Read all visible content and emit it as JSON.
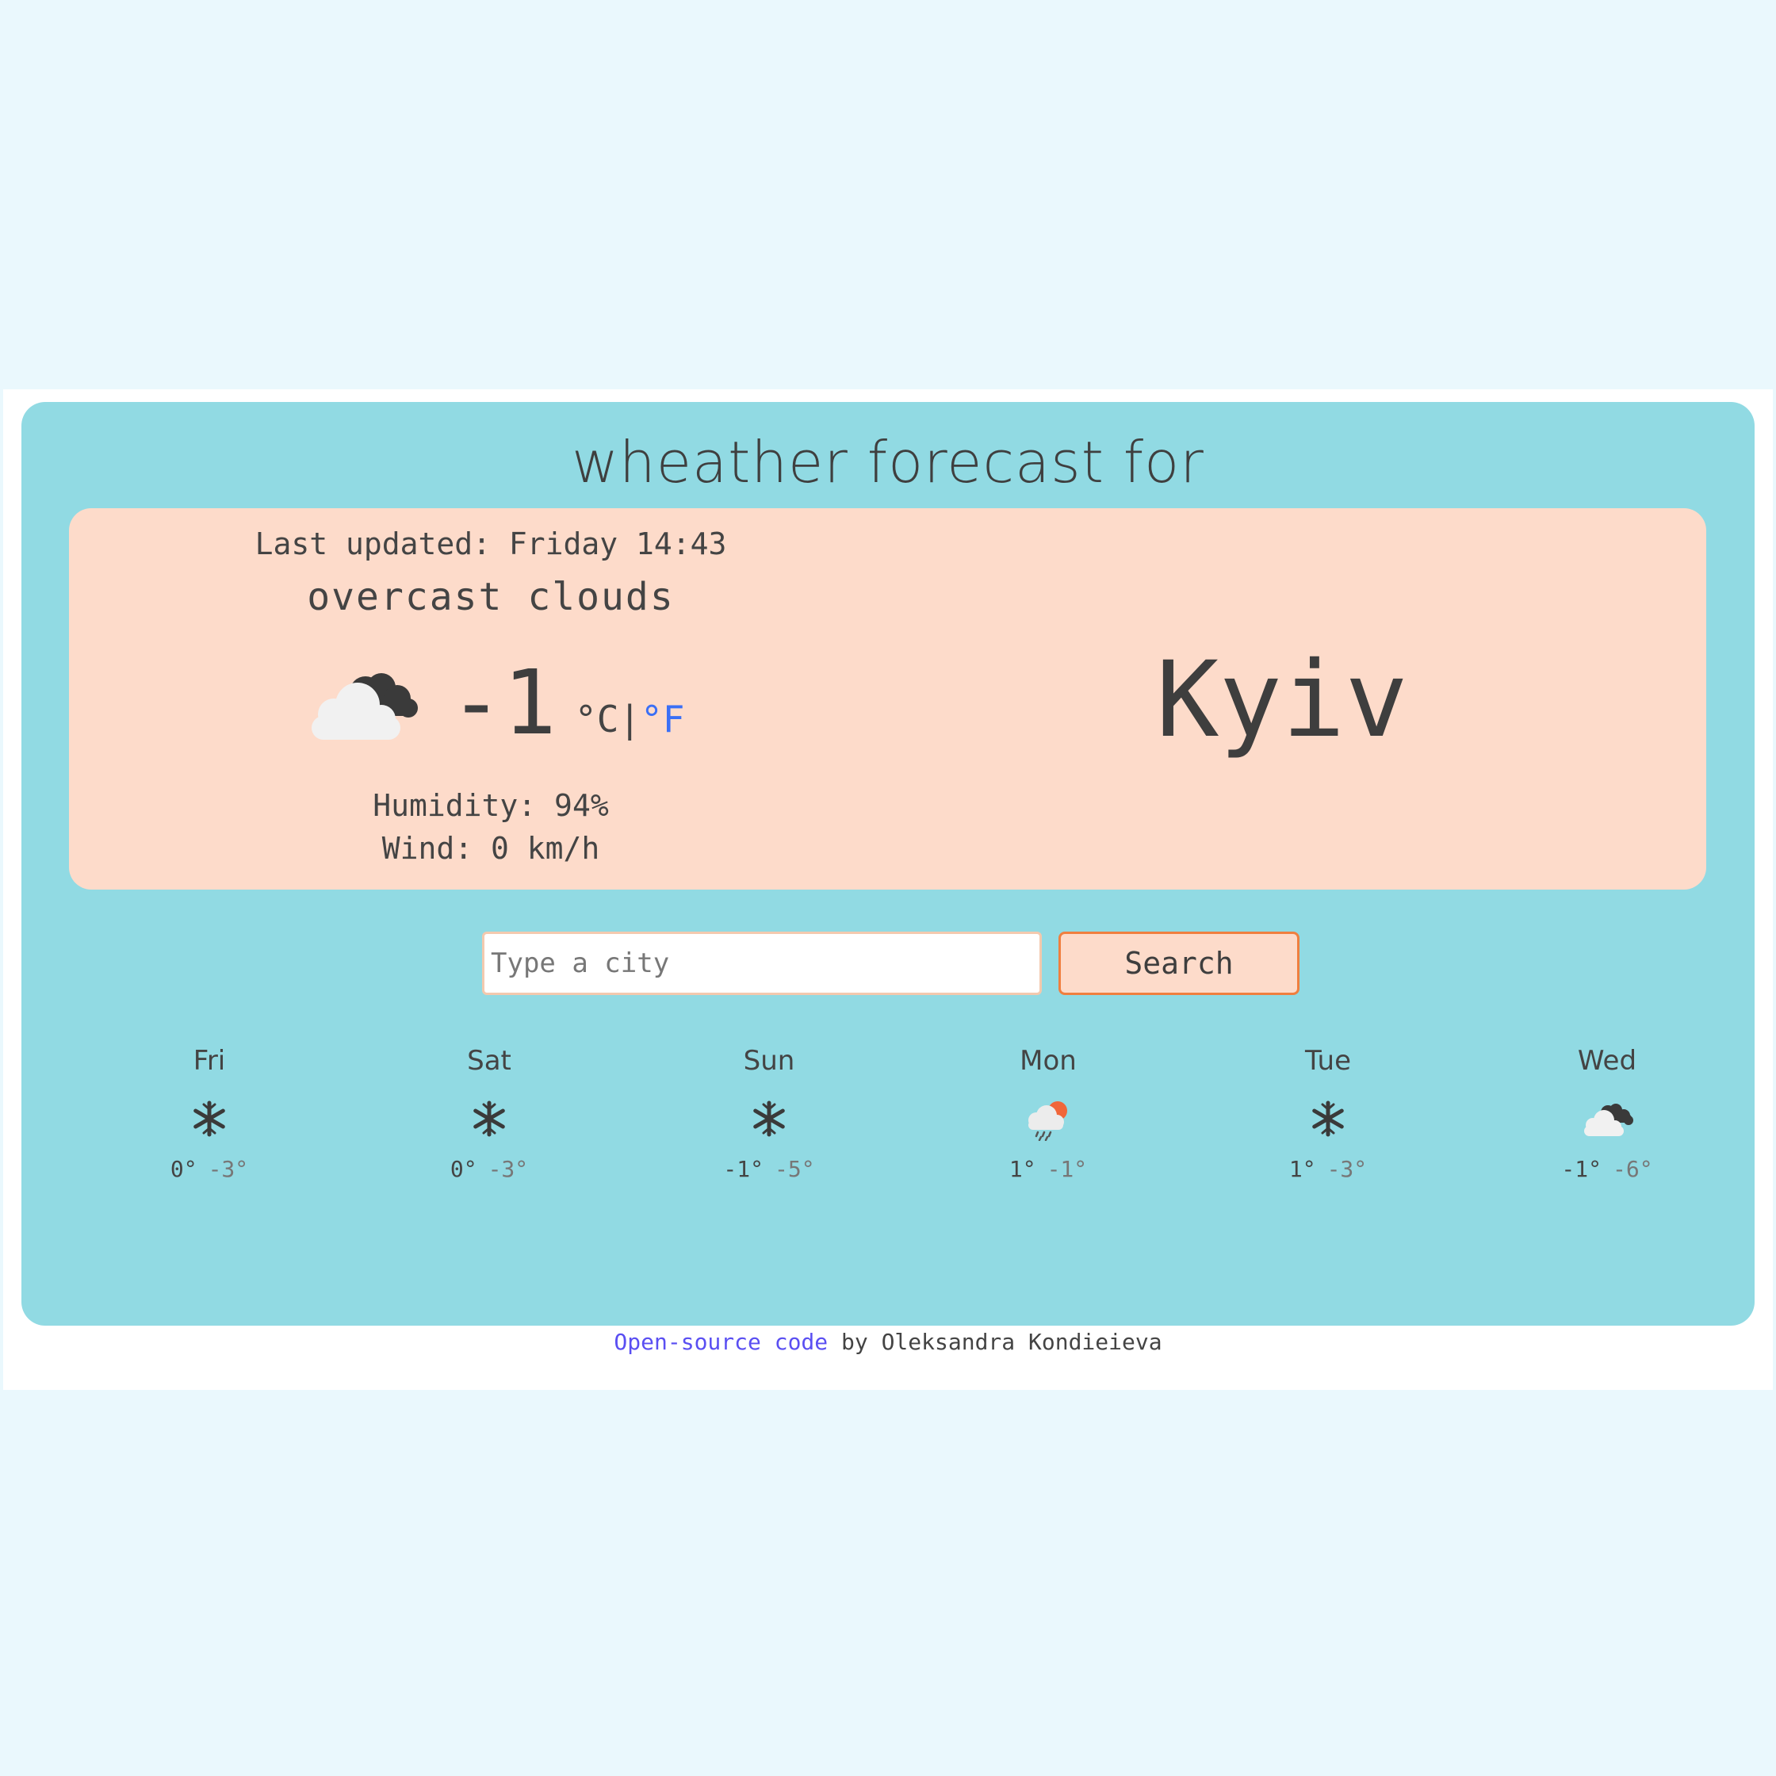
{
  "app": {
    "title": "wheather forecast for"
  },
  "current": {
    "last_updated": "Last updated: Friday 14:43",
    "description": "overcast clouds",
    "icon": "broken-clouds-icon",
    "temperature": "-1",
    "unit_c": "°C",
    "unit_separator": "|",
    "unit_f": "°F",
    "humidity": "Humidity: 94%",
    "wind": "Wind: 0 km/h",
    "city": "Kyiv"
  },
  "search": {
    "placeholder": "Type a city",
    "value": "",
    "button_label": "Search"
  },
  "forecast": [
    {
      "day": "Fri",
      "icon": "snow-icon",
      "max": "0°",
      "min": "-3°"
    },
    {
      "day": "Sat",
      "icon": "snow-icon",
      "max": "0°",
      "min": "-3°"
    },
    {
      "day": "Sun",
      "icon": "snow-icon",
      "max": "-1°",
      "min": "-5°"
    },
    {
      "day": "Mon",
      "icon": "rain-sun-icon",
      "max": "1°",
      "min": "-1°"
    },
    {
      "day": "Tue",
      "icon": "snow-icon",
      "max": "1°",
      "min": "-3°"
    },
    {
      "day": "Wed",
      "icon": "broken-clouds-icon",
      "max": "-1°",
      "min": "-6°"
    }
  ],
  "footer": {
    "link_text": "Open-source code",
    "rest_text": " by Oleksandra Kondieieva"
  },
  "colors": {
    "background": "#eaf8fd",
    "app_panel": "#91dae3",
    "current_card": "#fddbca",
    "button_border": "#f07f3f",
    "unit_link": "#3b6ff5",
    "footer_link": "#5a4ff2"
  }
}
